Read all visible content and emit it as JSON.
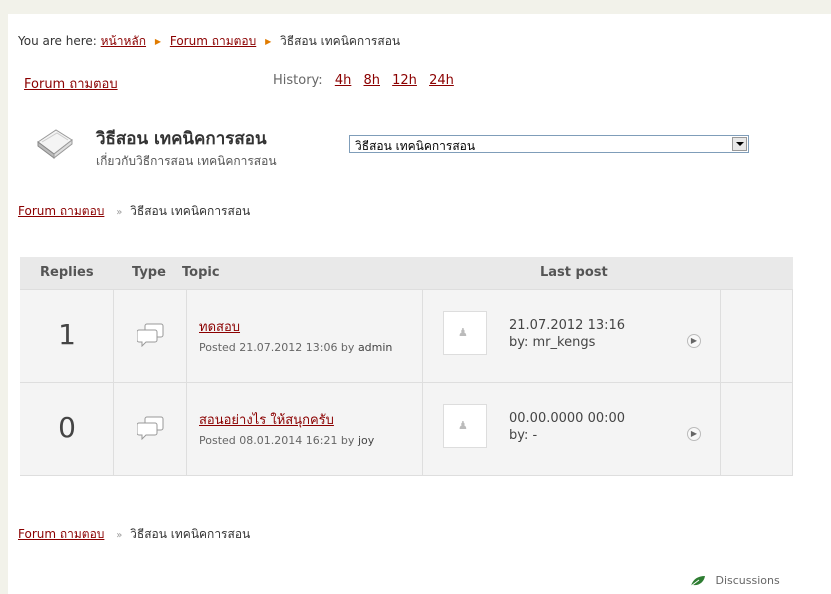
{
  "breadcrumb": {
    "prefix": "You are here:",
    "home": "หน้าหลัก",
    "forum": "Forum ถามตอบ",
    "current": "วิธีสอน เทคนิคการสอน"
  },
  "nav": {
    "forum_link": "Forum ถามตอบ",
    "history_label": "History:",
    "history_links": [
      "4h",
      "8h",
      "12h",
      "24h"
    ]
  },
  "forum": {
    "title": "วิธีสอน เทคนิคการสอน",
    "description": "เกี่ยวกับวิธีการสอน เทคนิคการสอน",
    "jump_value": "วิธีสอน เทคนิคการสอน",
    "icon": "book-icon"
  },
  "crumb": {
    "forum": "Forum ถามตอบ",
    "sep": "»",
    "current": "วิธีสอน เทคนิคการสอน"
  },
  "table": {
    "headers": {
      "replies": "Replies",
      "type": "Type",
      "topic": "Topic",
      "last_post": "Last post"
    },
    "rows": [
      {
        "replies": "1",
        "title": "ทดสอบ",
        "posted": "Posted 21.07.2012 13:06 by",
        "author": "admin",
        "last_date": "21.07.2012 13:16",
        "last_by": "by:  mr_kengs"
      },
      {
        "replies": "0",
        "title": "สอนอย่างไร ให้สนุกครับ",
        "posted": "Posted 08.01.2014 16:21 by",
        "author": "joy",
        "last_date": "00.00.0000 00:00",
        "last_by": "by:  -"
      }
    ]
  },
  "footer": {
    "discussions": "Discussions"
  },
  "colors": {
    "link": "#8b0000",
    "header_bg": "#e9e9e9",
    "row_bg": "#f4f4f4",
    "accent_arrow": "#e07b00",
    "leaf": "#2e7d32"
  }
}
